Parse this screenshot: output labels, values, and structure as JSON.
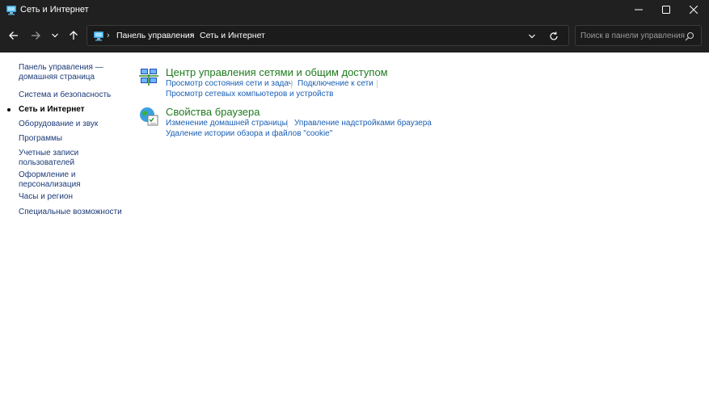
{
  "window": {
    "title": "Сеть и Интернет",
    "colors": {
      "titlebar": "#202020",
      "link": "#1a5fb4",
      "category_title": "#1e7a1e",
      "sidebar_link": "#1b3a78"
    }
  },
  "address": {
    "crumbs": [
      "Панель управления",
      "Сеть и Интернет"
    ]
  },
  "search": {
    "placeholder": "Поиск в панели управления"
  },
  "sidebar": {
    "home_label_line1": "Панель управления —",
    "home_label_line2": "домашняя страница",
    "items": [
      {
        "label": "Система и безопасность"
      },
      {
        "label": "Сеть и Интернет",
        "current": true
      },
      {
        "label": "Оборудование и звук"
      },
      {
        "label": "Программы"
      },
      {
        "label_line1": "Учетные записи",
        "label_line2": "пользователей"
      },
      {
        "label_line1": "Оформление и",
        "label_line2": "персонализация"
      },
      {
        "label": "Часы и регион"
      },
      {
        "label": "Специальные возможности"
      }
    ]
  },
  "categories": [
    {
      "title": "Центр управления сетями и общим доступом",
      "icon": "network-center-icon",
      "links": [
        "Просмотр состояния сети и задач",
        "Подключение к сети",
        "Просмотр сетевых компьютеров и устройств"
      ]
    },
    {
      "title": "Свойства браузера",
      "icon": "browser-properties-icon",
      "links": [
        "Изменение домашней страницы",
        "Управление надстройками браузера",
        "Удаление истории обзора и файлов \"cookie\""
      ]
    }
  ]
}
